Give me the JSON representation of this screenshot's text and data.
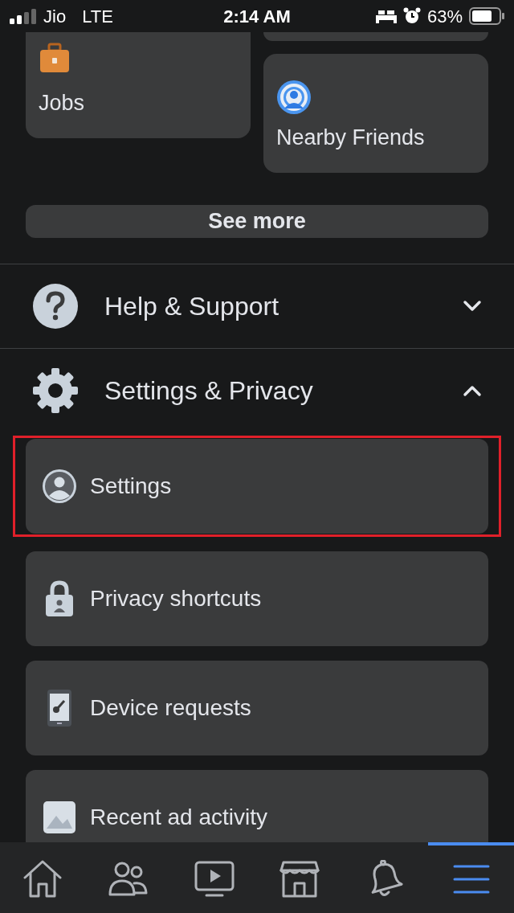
{
  "status_bar": {
    "carrier": "Jio",
    "network": "LTE",
    "time": "2:14 AM",
    "battery": "63%"
  },
  "shortcuts": [
    {
      "label": "Jobs",
      "kind": "jobs"
    },
    {
      "label": "Nearby Friends",
      "kind": "nearby"
    }
  ],
  "see_more": "See more",
  "sections": [
    {
      "title": "Help & Support",
      "kind": "help",
      "expanded": false
    },
    {
      "title": "Settings & Privacy",
      "kind": "settings",
      "expanded": true,
      "items": [
        {
          "label": "Settings",
          "kind": "account",
          "highlighted": true
        },
        {
          "label": "Privacy shortcuts",
          "kind": "lock",
          "highlighted": false
        },
        {
          "label": "Device requests",
          "kind": "device",
          "highlighted": false
        },
        {
          "label": "Recent ad activity",
          "kind": "ads",
          "highlighted": false
        }
      ]
    }
  ],
  "nav": [
    {
      "kind": "home",
      "selected": false
    },
    {
      "kind": "friends",
      "selected": false
    },
    {
      "kind": "watch",
      "selected": false
    },
    {
      "kind": "marketplace",
      "selected": false
    },
    {
      "kind": "notifications",
      "selected": false
    },
    {
      "kind": "menu",
      "selected": true
    }
  ]
}
